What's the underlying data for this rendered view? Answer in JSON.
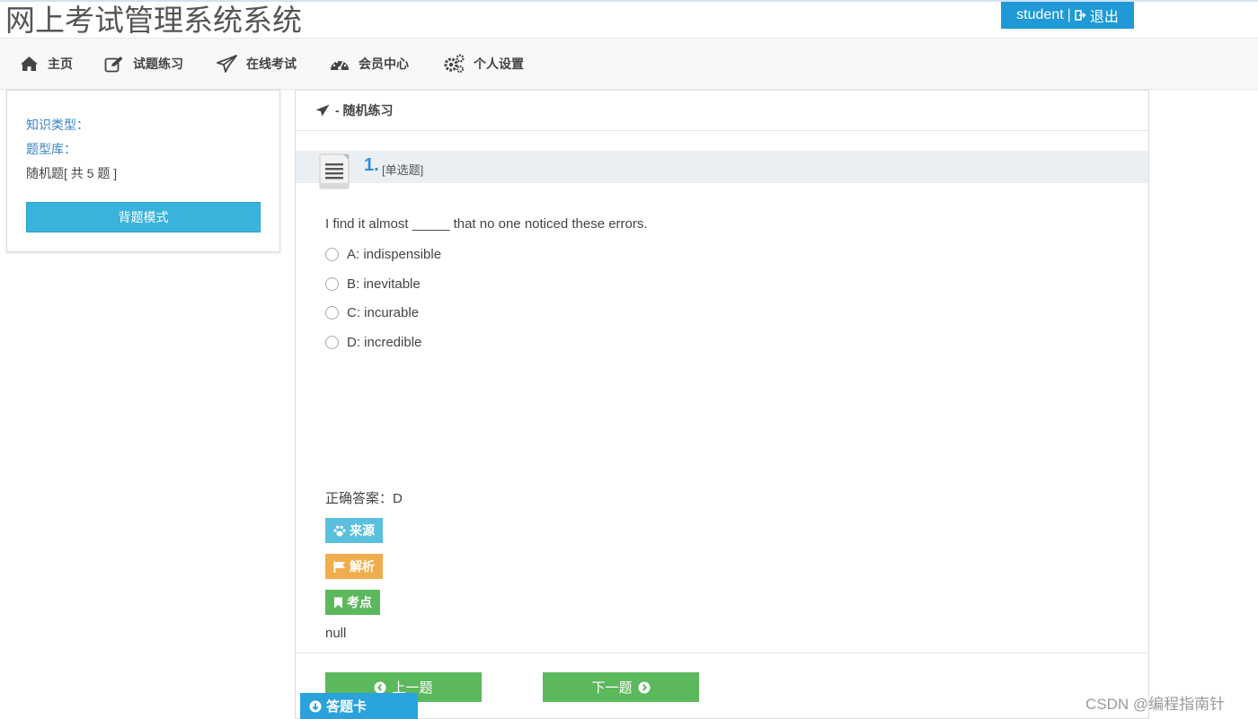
{
  "header": {
    "site_title": "网上考试管理系统系统",
    "username": "student",
    "separator": "|",
    "logout_label": "退出",
    "accent_color": "#1f9ad6"
  },
  "nav": {
    "items": [
      {
        "label": "主页",
        "icon": "home-icon"
      },
      {
        "label": "试题练习",
        "icon": "edit-icon"
      },
      {
        "label": "在线考试",
        "icon": "paper-plane-icon"
      },
      {
        "label": "会员中心",
        "icon": "dashboard-icon"
      },
      {
        "label": "个人设置",
        "icon": "gears-icon"
      }
    ]
  },
  "sidebar": {
    "knowledge_type_label": "知识类型：",
    "question_bank_label": "题型库：",
    "random_count": "随机题[ 共 5 题 ]",
    "recite_mode_label": "背题模式"
  },
  "panel": {
    "title": "- 随机练习",
    "question": {
      "number": "1.",
      "type": "[单选题]",
      "text": "I find it almost _____ that no one noticed these errors.",
      "options": [
        {
          "label": "A: indispensible"
        },
        {
          "label": "B: inevitable"
        },
        {
          "label": "C: incurable"
        },
        {
          "label": "D: incredible"
        }
      ],
      "correct_answer": "正确答案：D",
      "tags": {
        "source_label": "来源",
        "analysis_label": "解析",
        "point_label": "考点"
      },
      "point_value": "null"
    },
    "prev_label": "上一题",
    "next_label": "下一题"
  },
  "answer_card_label": "答题卡",
  "watermark": "CSDN @编程指南针"
}
